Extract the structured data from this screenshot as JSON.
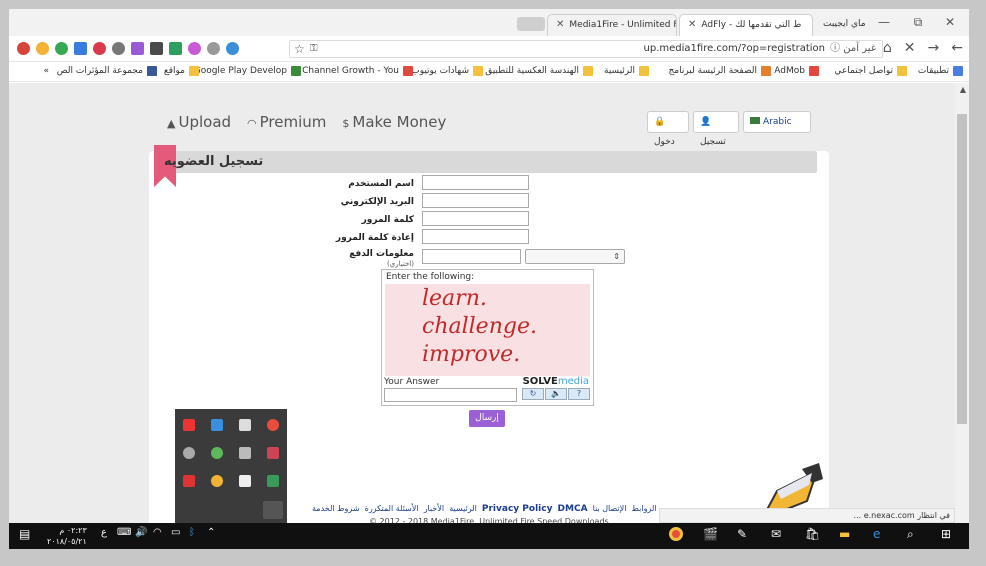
{
  "browser": {
    "tabs": [
      {
        "label": "Media1Fire - Unlimited F"
      },
      {
        "label": "AdFly - ط التي تقدمها لك"
      },
      {
        "label": "ماي ايجيبت"
      }
    ],
    "window_controls": {
      "minimize": "—",
      "maximize": "⧉",
      "close": "✕"
    },
    "address": {
      "url": "up.media1fire.com/?op=registration",
      "security_label": "ⓘ غير آمن"
    },
    "nav": {
      "home": "⌂",
      "stop": "✕",
      "back": "←",
      "forward": "→"
    },
    "bookmarks": [
      {
        "label": "تطبيقات",
        "color": "#4a7de0"
      },
      {
        "label": "تواصل اجتماعي",
        "color": "#f2c23c"
      },
      {
        "label": "AdMob",
        "color": "#e2483d"
      },
      {
        "label": "الصفحة الرئيسة لبرنامج",
        "color": "#e47f2e"
      },
      {
        "label": "الرئيسية",
        "color": "#f2c23c"
      },
      {
        "label": "الهندسة العكسية للتطبيق",
        "color": "#f2c23c"
      },
      {
        "label": "شهادات يوتيوب",
        "color": "#f2c23c"
      },
      {
        "label": "Channel Growth - You",
        "color": "#e2483d"
      },
      {
        "label": "Google Play Develop",
        "color": "#3b8b3b"
      },
      {
        "label": "مواقع",
        "color": "#f2c23c"
      },
      {
        "label": "مجموعة المؤثرات الص",
        "color": "#3b5998"
      }
    ],
    "bookmarks_overflow": "»"
  },
  "site": {
    "nav": [
      {
        "icon": "upload-icon",
        "glyph": "▲",
        "label": "Upload"
      },
      {
        "icon": "premium-icon",
        "glyph": "◠",
        "label": "Premium"
      },
      {
        "icon": "money-icon",
        "glyph": "$",
        "label": "Make Money"
      }
    ],
    "lang_button": "Arabic",
    "register_button": "تسجيل",
    "login_button": "دخول",
    "page_title": "تسجيل العضويه",
    "form": {
      "username_label": "اسم المستخدم",
      "email_label": "البريد الإلكتروني",
      "password_label": "كلمة المرور",
      "password_confirm_label": "إعادة كلمة المرور",
      "payment_label": "معلومات الدفع",
      "payment_optional": "(اختياري)",
      "payment_select_value": "",
      "submit_label": "إرسال"
    },
    "captcha": {
      "prompt": "Enter the following:",
      "lines": [
        "learn.",
        "challenge.",
        "improve."
      ],
      "answer_label": "Your Answer",
      "brand_solve": "SOLVE",
      "brand_media": "media",
      "buttons": [
        "↻",
        "🔈",
        "?"
      ]
    },
    "footer": {
      "links": [
        "شروط الخدمة",
        "الأسئلة المتكررة",
        "الأخبار",
        "الرئيسية",
        "DMCA",
        "Privacy Policy",
        "الإتصال بنا",
        "الروابط"
      ],
      "copyright": "© 2012 - 2018 Media1Fire, Unlimited Fire Speed Downloads"
    },
    "status_text": "في انتظار e.nexac.com ..."
  },
  "taskbar": {
    "time": "٠٢:٢٣ م",
    "date": "٢٠١٨/٠٥/٢١",
    "lang": "ع",
    "search_icon": "⌕",
    "start_icon": "⊞"
  }
}
